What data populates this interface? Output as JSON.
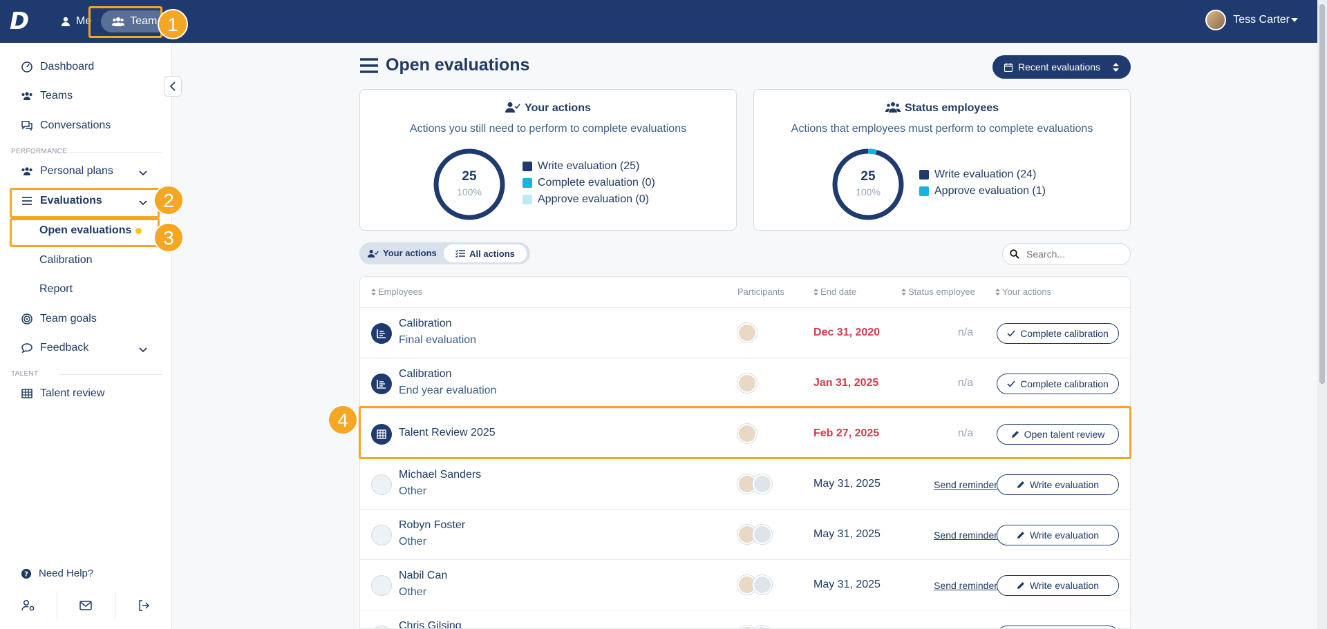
{
  "topbar": {
    "me_label": "Me",
    "team_label": "Team",
    "user_name": "Tess Carter"
  },
  "sidebar": {
    "dashboard": "Dashboard",
    "teams": "Teams",
    "conversations": "Conversations",
    "section_performance": "PERFORMANCE",
    "personal_plans": "Personal plans",
    "evaluations": "Evaluations",
    "open_evaluations": "Open evaluations",
    "calibration": "Calibration",
    "report": "Report",
    "team_goals": "Team goals",
    "feedback": "Feedback",
    "section_talent": "TALENT",
    "talent_review": "Talent review",
    "need_help": "Need Help?"
  },
  "badges": [
    "1",
    "2",
    "3",
    "4"
  ],
  "main": {
    "title": "Open evaluations",
    "recent_button": "Recent evaluations",
    "your_actions_card": {
      "title": "Your actions",
      "subtitle": "Actions you still need to perform to complete evaluations",
      "total": "25",
      "percent": "100%",
      "legend": [
        {
          "label": "Write evaluation (25)",
          "color": "#1f3a6e"
        },
        {
          "label": "Complete evaluation (0)",
          "color": "#16b3e0"
        },
        {
          "label": "Approve evaluation (0)",
          "color": "#bfe9f6"
        }
      ]
    },
    "status_card": {
      "title": "Status employees",
      "subtitle": "Actions that employees must perform to complete evaluations",
      "total": "25",
      "percent": "100%",
      "legend": [
        {
          "label": "Write evaluation (24)",
          "color": "#1f3a6e"
        },
        {
          "label": "Approve evaluation (1)",
          "color": "#16b3e0"
        }
      ]
    },
    "toggle": {
      "your_actions": "Your actions",
      "all_actions": "All actions"
    },
    "search": {
      "placeholder": "Search..."
    },
    "table": {
      "headers": {
        "employees": "Employees",
        "participants": "Participants",
        "end_date": "End date",
        "status_employee": "Status employee",
        "your_actions": "Your actions"
      },
      "rows": [
        {
          "title": "Calibration",
          "sub": "Final evaluation",
          "date": "Dec 31, 2020",
          "status": "n/a",
          "action": "Complete calibration"
        },
        {
          "title": "Calibration",
          "sub": "End year evaluation",
          "date": "Jan 31, 2025",
          "status": "n/a",
          "action": "Complete calibration"
        },
        {
          "title": "Talent Review 2025",
          "sub": "",
          "date": "Feb 27, 2025",
          "status": "n/a",
          "action": "Open talent review"
        },
        {
          "title": "Michael Sanders",
          "sub": "Other",
          "date": "May 31, 2025",
          "status": "Send reminder",
          "action": "Write evaluation"
        },
        {
          "title": "Robyn Foster",
          "sub": "Other",
          "date": "May 31, 2025",
          "status": "Send reminder",
          "action": "Write evaluation"
        },
        {
          "title": "Nabil Can",
          "sub": "Other",
          "date": "May 31, 2025",
          "status": "Send reminder",
          "action": "Write evaluation"
        },
        {
          "title": "Chris Gilsing",
          "sub": "",
          "date": "",
          "status": "",
          "action": ""
        }
      ]
    }
  }
}
